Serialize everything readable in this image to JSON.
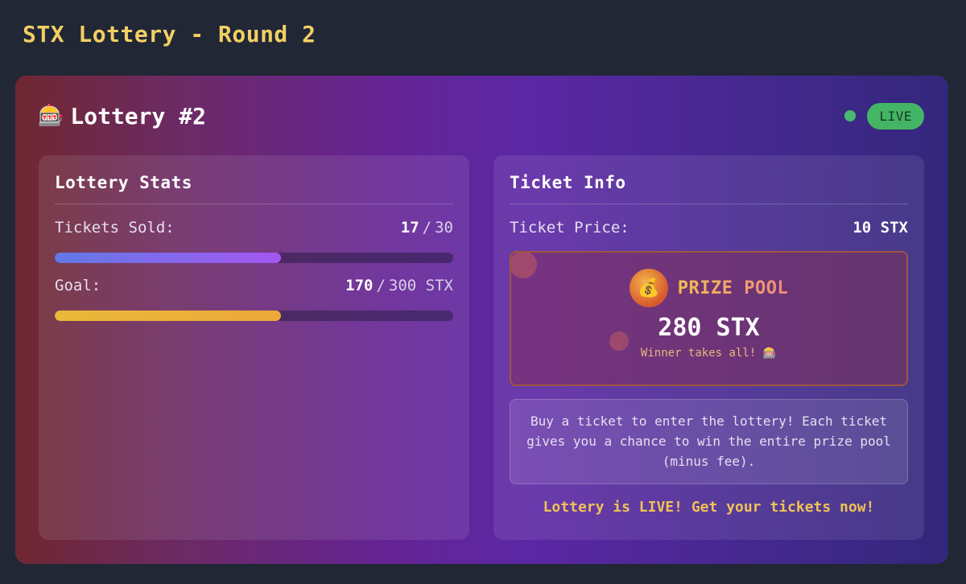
{
  "page": {
    "title": "STX Lottery - Round 2"
  },
  "lottery": {
    "icon": "slot-machine-icon",
    "title": "Lottery #2",
    "status_label": "LIVE",
    "status_color": "#48bb6e"
  },
  "stats": {
    "heading": "Lottery Stats",
    "tickets_label": "Tickets Sold:",
    "tickets_sold": "17",
    "tickets_separator": "/",
    "tickets_total": "30",
    "tickets_progress": 0.5667,
    "goal_label": "Goal:",
    "goal_current": "170",
    "goal_separator": "/",
    "goal_total": "300 STX",
    "goal_progress": 0.5667
  },
  "ticket_info": {
    "heading": "Ticket Info",
    "price_label": "Ticket Price:",
    "price_value": "10 STX",
    "prize_icon": "money-bag-icon",
    "prize_label": "PRIZE POOL",
    "prize_amount": "280 STX",
    "prize_subtext": "Winner takes all! 🎰",
    "description": "Buy a ticket to enter the lottery! Each ticket gives you a chance to win the entire prize pool (minus fee).",
    "cta": "Lottery is LIVE! Get your tickets now!"
  },
  "colors": {
    "accent_gold": "#f3cf64",
    "live_green": "#44b565",
    "tickets_bar": "#6279e6",
    "goal_bar": "#e9b93a"
  }
}
